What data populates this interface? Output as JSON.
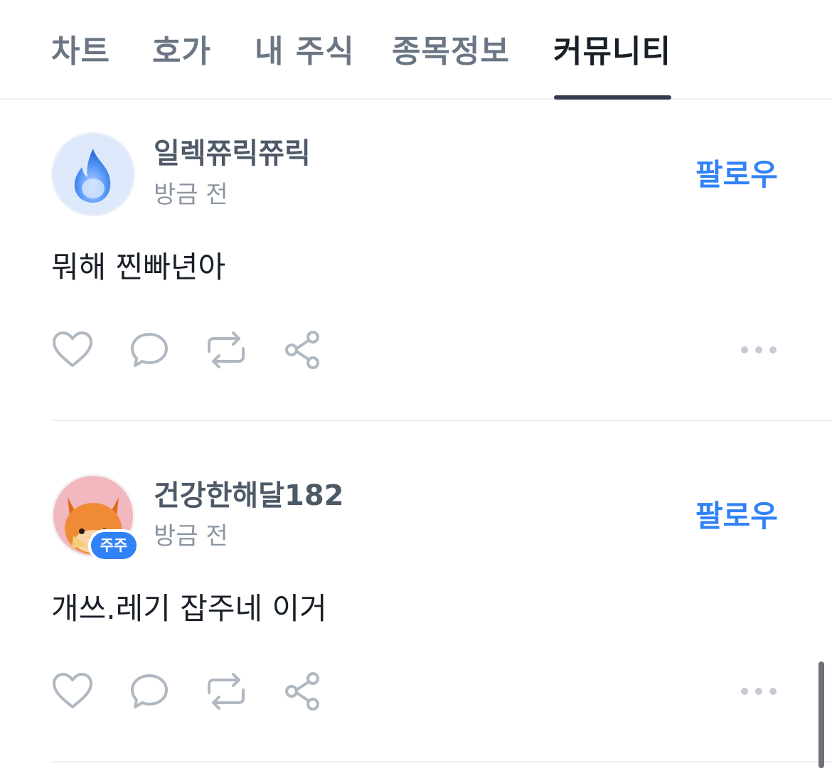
{
  "tabs": [
    {
      "label": "차트"
    },
    {
      "label": "호가"
    },
    {
      "label": "내 주식"
    },
    {
      "label": "종목정보"
    },
    {
      "label": "커뮤니티"
    }
  ],
  "active_tab": "커뮤니티",
  "posts": [
    {
      "username": "일렉쮸릭쮸릭",
      "time": "방금 전",
      "follow_label": "팔로우",
      "content": "뭐해 찐빠년아",
      "avatar_icon": "fire-emoji-avatar"
    },
    {
      "username": "건강한해달182",
      "time": "방금 전",
      "follow_label": "팔로우",
      "content": "개쓰.레기 잡주네 이거",
      "avatar_icon": "fox-emoji-avatar",
      "badge": "주주"
    }
  ],
  "actions": [
    "heart-icon",
    "comment-icon",
    "repost-icon",
    "share-icon",
    "more-icon"
  ],
  "colors": {
    "accent": "#3182f6",
    "icon_gray": "#b0b8c1",
    "text_primary": "#191f28",
    "text_secondary": "#4e5968",
    "text_tertiary": "#8b95a1"
  }
}
